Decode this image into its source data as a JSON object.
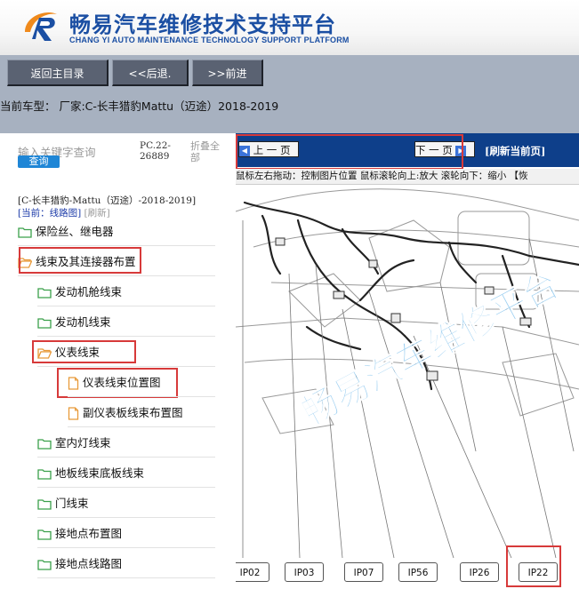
{
  "header": {
    "title": "畅易汽车维修技术支持平台",
    "subtitle": "CHANG YI AUTO MAINTENANCE TECHNOLOGY SUPPORT PLATFORM"
  },
  "nav": {
    "home_label": "返回主目录",
    "back_label": "<<后退.",
    "forward_label": ">>前进"
  },
  "model_bar": {
    "text": "当前车型： 厂家:C-长丰猎豹Mattu（迈途）2018-2019"
  },
  "search": {
    "label": "输入关键字查询",
    "button": "查询",
    "pc_code": "PC.22-26889",
    "fold_all": "折叠全部"
  },
  "tree": {
    "path": "[C-长丰猎豹-Mattu（迈途）-2018-2019]",
    "current_prefix": "[当前：线路图]",
    "refresh": "[刷新]",
    "items": [
      {
        "label": "保险丝、继电器",
        "type": "folder"
      },
      {
        "label": "线束及其连接器布置",
        "type": "folder-open"
      },
      {
        "label": "发动机舱线束",
        "type": "folder"
      },
      {
        "label": "发动机线束",
        "type": "folder"
      },
      {
        "label": "仪表线束",
        "type": "folder-open"
      },
      {
        "label": "仪表线束位置图",
        "type": "file"
      },
      {
        "label": "副仪表板线束布置图",
        "type": "file"
      },
      {
        "label": "室内灯线束",
        "type": "folder"
      },
      {
        "label": "地板线束底板线束",
        "type": "folder"
      },
      {
        "label": "门线束",
        "type": "folder"
      },
      {
        "label": "接地点布置图",
        "type": "folder"
      },
      {
        "label": "接地点线路图",
        "type": "folder"
      }
    ]
  },
  "viewer": {
    "prev_page": "上 一 页",
    "next_page": "下 一 页",
    "refresh_first": "[刷新当前页]",
    "hint": "鼠标左右拖动：控制图片位置  鼠标滚轮向上:放大  滚轮向下：缩小 【恢",
    "watermark": "畅易汽车维修平台",
    "connectors": [
      "IP02",
      "IP03",
      "IP07",
      "IP56",
      "IP26",
      "IP22"
    ]
  },
  "colors": {
    "brand_blue": "#1b4fa3",
    "nav_gray": "#a7b1c0",
    "viewer_bar": "#0e3f8a",
    "highlight_red": "#d73a3a",
    "folder_green": "#3aa04a",
    "file_orange": "#e89a3a"
  },
  "icons": {
    "folder": "folder-icon",
    "file": "file-icon",
    "arrow_left": "arrow-left-icon",
    "arrow_right": "arrow-right-icon"
  }
}
